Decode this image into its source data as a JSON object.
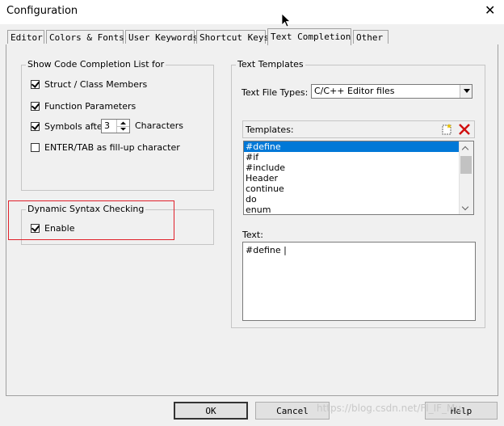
{
  "window": {
    "title": "Configuration",
    "close_glyph": "✕"
  },
  "tabs": [
    {
      "label": "Editor",
      "active": false
    },
    {
      "label": "Colors & Fonts",
      "active": false
    },
    {
      "label": "User Keywords",
      "active": false
    },
    {
      "label": "Shortcut Keys",
      "active": false
    },
    {
      "label": "Text Completion",
      "active": true
    },
    {
      "label": "Other",
      "active": false
    }
  ],
  "code_completion": {
    "title": "Show Code Completion List for",
    "options": [
      {
        "label": "Struct / Class Members",
        "checked": true
      },
      {
        "label": "Function Parameters",
        "checked": true
      },
      {
        "label": "Symbols after",
        "checked": true
      },
      {
        "label": "ENTER/TAB as fill-up character",
        "checked": false
      }
    ],
    "symbols_value": "3",
    "characters_label": "Characters"
  },
  "syntax_checking": {
    "title": "Dynamic Syntax Checking",
    "enable_label": "Enable",
    "enable_checked": true
  },
  "text_templates": {
    "title": "Text Templates",
    "file_types_label": "Text File Types:",
    "file_types_value": "C/C++ Editor files",
    "templates_label": "Templates:",
    "templates": [
      "#define",
      "#if",
      "#include",
      "Header",
      "continue",
      "do",
      "enum"
    ],
    "selected_index": 0,
    "text_label": "Text:",
    "text_value": "#define |"
  },
  "buttons": {
    "ok": "OK",
    "cancel": "Cancel",
    "help": "Help"
  },
  "watermark": "https://blog.csdn.net/Fl_IF_Mu",
  "colors": {
    "selection": "#0078d7",
    "highlight_box": "#e0202a"
  }
}
